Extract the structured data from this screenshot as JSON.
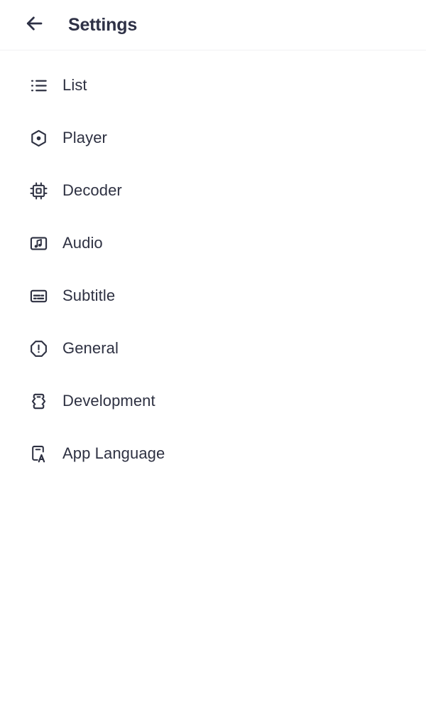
{
  "header": {
    "title": "Settings",
    "back_icon": "arrow-left-icon"
  },
  "menu": {
    "items": [
      {
        "label": "List",
        "icon": "list-icon"
      },
      {
        "label": "Player",
        "icon": "player-hexagon-icon"
      },
      {
        "label": "Decoder",
        "icon": "cpu-chip-icon"
      },
      {
        "label": "Audio",
        "icon": "music-note-icon"
      },
      {
        "label": "Subtitle",
        "icon": "subtitle-captions-icon"
      },
      {
        "label": "General",
        "icon": "octagon-alert-icon"
      },
      {
        "label": "Development",
        "icon": "code-braces-icon"
      },
      {
        "label": "App Language",
        "icon": "language-letter-a-icon"
      }
    ]
  },
  "colors": {
    "text": "#2e3142",
    "title": "#2e3146",
    "background": "#ffffff",
    "divider": "#f1f1f3"
  }
}
